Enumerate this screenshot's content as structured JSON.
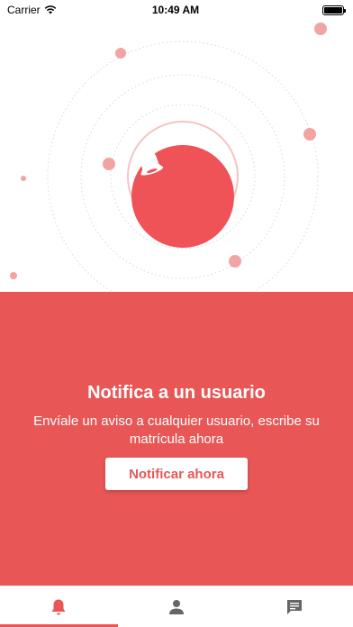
{
  "status_bar": {
    "carrier": "Carrier",
    "time": "10:49 AM",
    "battery_level": 1.0
  },
  "hero": {
    "icon": "bell-icon",
    "accent_color": "#ef5257"
  },
  "panel": {
    "title": "Notifica a un usuario",
    "description": "Envíale un aviso a cualquier usuario, escribe su matrícula ahora",
    "button_label": "Notificar ahora",
    "background_color": "#e85656"
  },
  "tabs": [
    {
      "icon": "bell-icon",
      "active": true
    },
    {
      "icon": "person-icon",
      "active": false
    },
    {
      "icon": "chat-icon",
      "active": false
    }
  ]
}
